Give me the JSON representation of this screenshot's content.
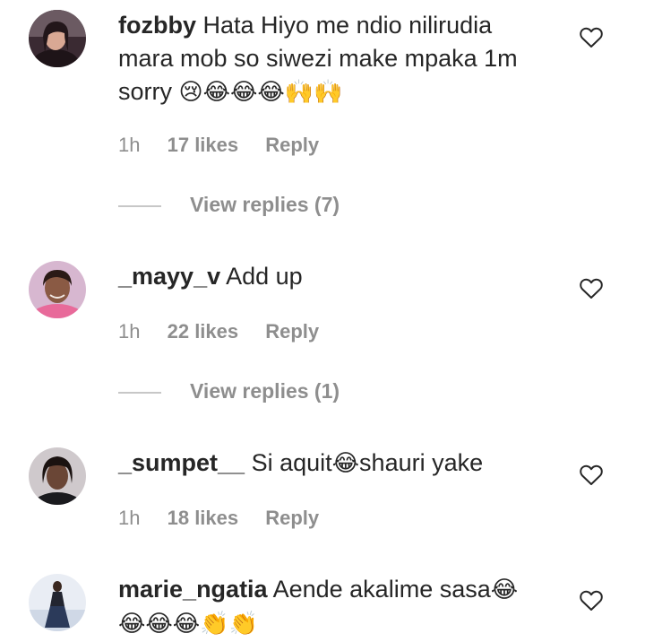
{
  "comments": [
    {
      "username": "fozbby",
      "text": "Hata Hiyo me ndio nilirudia mara mob so siwezi make mpaka 1m sorry ",
      "emoji": "😢😂😂😂🙌🙌",
      "time": "1h",
      "likes": "17 likes",
      "reply": "Reply",
      "view_replies": "View replies (7)"
    },
    {
      "username": "_mayy_v",
      "text": "Add up",
      "emoji": "",
      "time": "1h",
      "likes": "22 likes",
      "reply": "Reply",
      "view_replies": "View replies (1)"
    },
    {
      "username": "_sumpet__",
      "text_before": "Si aquit",
      "emoji": "😂",
      "text_after": "shauri yake",
      "time": "1h",
      "likes": "18 likes",
      "reply": "Reply"
    },
    {
      "username": "marie_ngatia",
      "text": "Aende akalime sasa",
      "emoji": "😂",
      "emoji_line2": "😂😂😂👏👏"
    }
  ],
  "icons": {
    "heart": "heart-outline-icon"
  },
  "colors": {
    "text": "#262626",
    "secondary": "#8e8e8e",
    "divider": "#c7c7c7"
  }
}
